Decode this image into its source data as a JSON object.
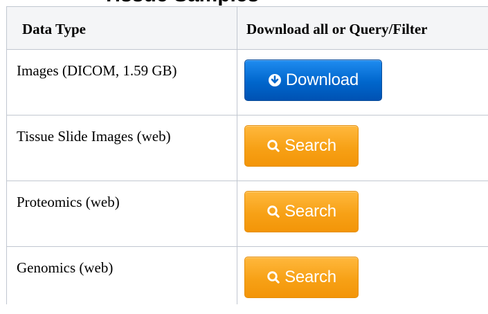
{
  "page": {
    "clipped_heading": "Tissue Samples"
  },
  "table": {
    "headers": {
      "data_type": "Data Type",
      "action": "Download all or Query/Filter"
    },
    "rows": [
      {
        "data_type": "Images (DICOM, 1.59 GB)",
        "button_label": "Download",
        "button_icon": "download-circle-icon",
        "button_color": "#0066cc"
      },
      {
        "data_type": "Tissue Slide Images (web)",
        "button_label": "Search",
        "button_icon": "search-icon",
        "button_color": "#f7a116"
      },
      {
        "data_type": "Proteomics (web)",
        "button_label": "Search",
        "button_icon": "search-icon",
        "button_color": "#f7a116"
      },
      {
        "data_type": "Genomics (web)",
        "button_label": "Search",
        "button_icon": "search-icon",
        "button_color": "#f7a116"
      }
    ]
  },
  "colors": {
    "border": "#c1c7d0",
    "header_bg": "#f4f5f7",
    "download_blue": "#0066cc",
    "search_orange": "#f7a116"
  }
}
